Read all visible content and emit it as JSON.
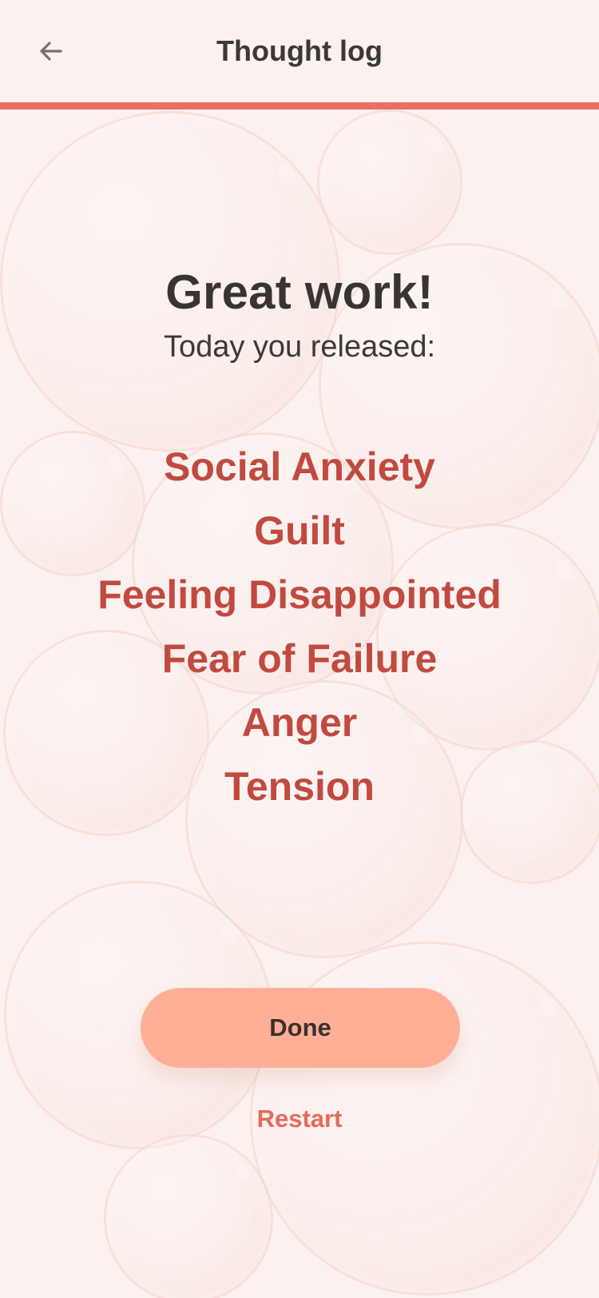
{
  "header": {
    "title": "Thought log",
    "back_icon": "arrow-left-icon"
  },
  "main": {
    "headline": "Great work!",
    "subheadline": "Today you released:",
    "released_items": [
      "Social Anxiety",
      "Guilt",
      "Feeling Disappointed",
      "Fear of Failure",
      "Anger",
      "Tension"
    ]
  },
  "actions": {
    "done_label": "Done",
    "restart_label": "Restart"
  },
  "colors": {
    "background": "#fbf1ef",
    "header_line": "#e86f61",
    "released_text": "#c14a40",
    "done_button": "#ffae96",
    "restart_text": "#e46c58"
  }
}
